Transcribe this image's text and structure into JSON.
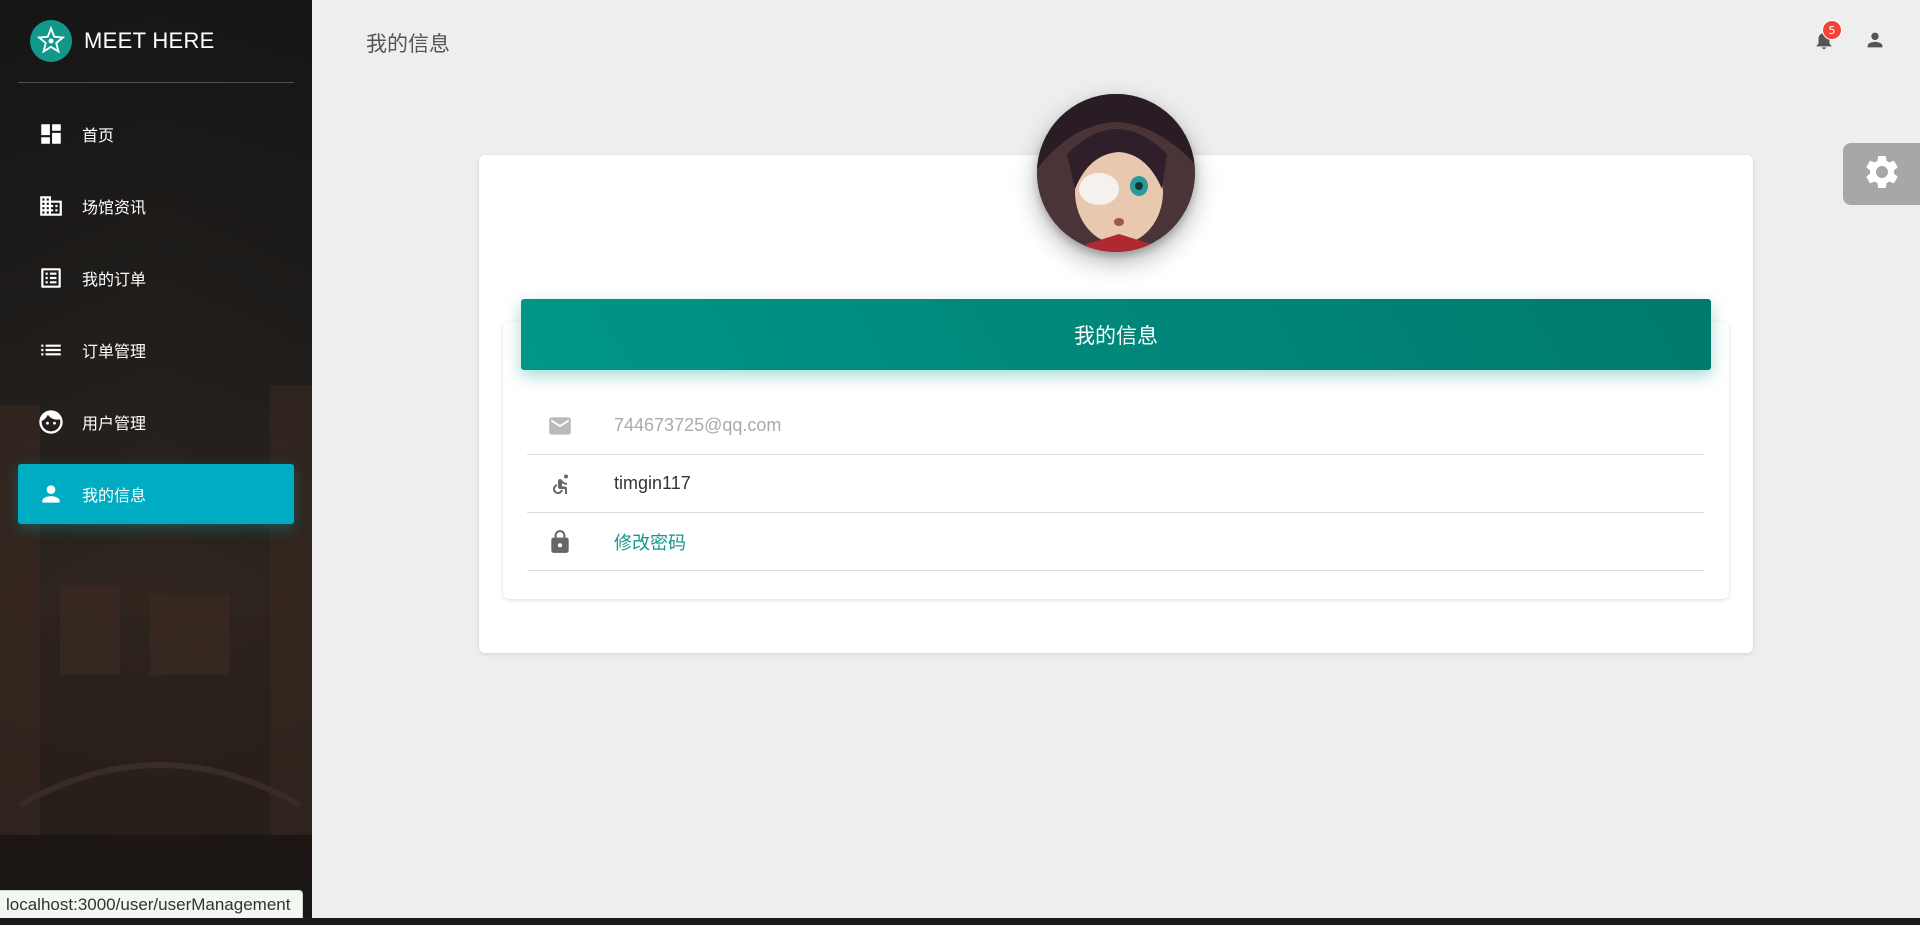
{
  "brand": {
    "name": "MEET HERE",
    "icon": "star-logo-icon"
  },
  "sidebar": {
    "items": [
      {
        "label": "首页",
        "icon": "dashboard-icon",
        "active": false
      },
      {
        "label": "场馆资讯",
        "icon": "building-icon",
        "active": false
      },
      {
        "label": "我的订单",
        "icon": "list-alt-icon",
        "active": false
      },
      {
        "label": "订单管理",
        "icon": "list-icon",
        "active": false
      },
      {
        "label": "用户管理",
        "icon": "face-icon",
        "active": false
      },
      {
        "label": "我的信息",
        "icon": "person-icon",
        "active": true
      }
    ]
  },
  "header": {
    "title": "我的信息",
    "notifications_count": "5"
  },
  "profile": {
    "card_title": "我的信息",
    "email": "744673725@qq.com",
    "username": "timgin117",
    "change_password": "修改密码"
  },
  "status_bar": {
    "url": "localhost:3000/user/userManagement"
  },
  "colors": {
    "active_nav": "#00acc1",
    "header_gradient_start": "#009688",
    "header_gradient_end": "#00796b",
    "link": "#16968a",
    "badge": "#f44336"
  }
}
